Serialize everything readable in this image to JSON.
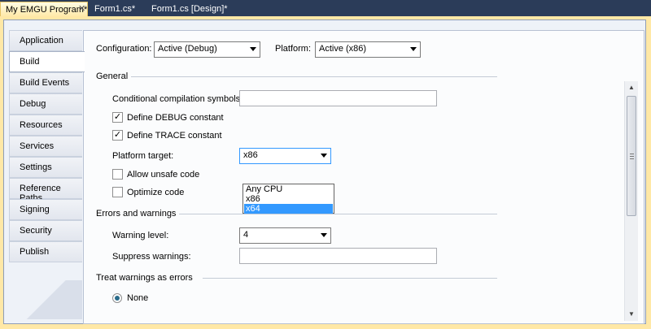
{
  "tabs": [
    {
      "label": "My EMGU Program*",
      "active": true
    },
    {
      "label": "Form1.cs*",
      "active": false
    },
    {
      "label": "Form1.cs [Design]*",
      "active": false
    }
  ],
  "sidebar": {
    "items": [
      {
        "label": "Application"
      },
      {
        "label": "Build",
        "selected": true
      },
      {
        "label": "Build Events"
      },
      {
        "label": "Debug"
      },
      {
        "label": "Resources"
      },
      {
        "label": "Services"
      },
      {
        "label": "Settings"
      },
      {
        "label": "Reference Paths"
      },
      {
        "label": "Signing"
      },
      {
        "label": "Security"
      },
      {
        "label": "Publish"
      }
    ]
  },
  "config": {
    "configuration_label": "Configuration:",
    "configuration_value": "Active (Debug)",
    "platform_label": "Platform:",
    "platform_value": "Active (x86)"
  },
  "general": {
    "title": "General",
    "cond_symbols_label": "Conditional compilation symbols:",
    "cond_symbols_value": "",
    "define_debug_label": "Define DEBUG constant",
    "define_debug_checked": true,
    "define_trace_label": "Define TRACE constant",
    "define_trace_checked": true,
    "platform_target_label": "Platform target:",
    "platform_target_value": "x86",
    "platform_target_options": [
      "Any CPU",
      "x86",
      "x64"
    ],
    "platform_target_highlighted": "x64",
    "allow_unsafe_label": "Allow unsafe code",
    "allow_unsafe_checked": false,
    "optimize_label": "Optimize code",
    "optimize_checked": false
  },
  "errors": {
    "title": "Errors and warnings",
    "warning_level_label": "Warning level:",
    "warning_level_value": "4",
    "suppress_label": "Suppress warnings:",
    "suppress_value": ""
  },
  "treat_warnings": {
    "title": "Treat warnings as errors",
    "none_label": "None",
    "none_selected": true
  },
  "colors": {
    "tabstrip_bg": "#2b3c59",
    "active_tab": "#ffe8a6",
    "highlight": "#3399ff"
  }
}
